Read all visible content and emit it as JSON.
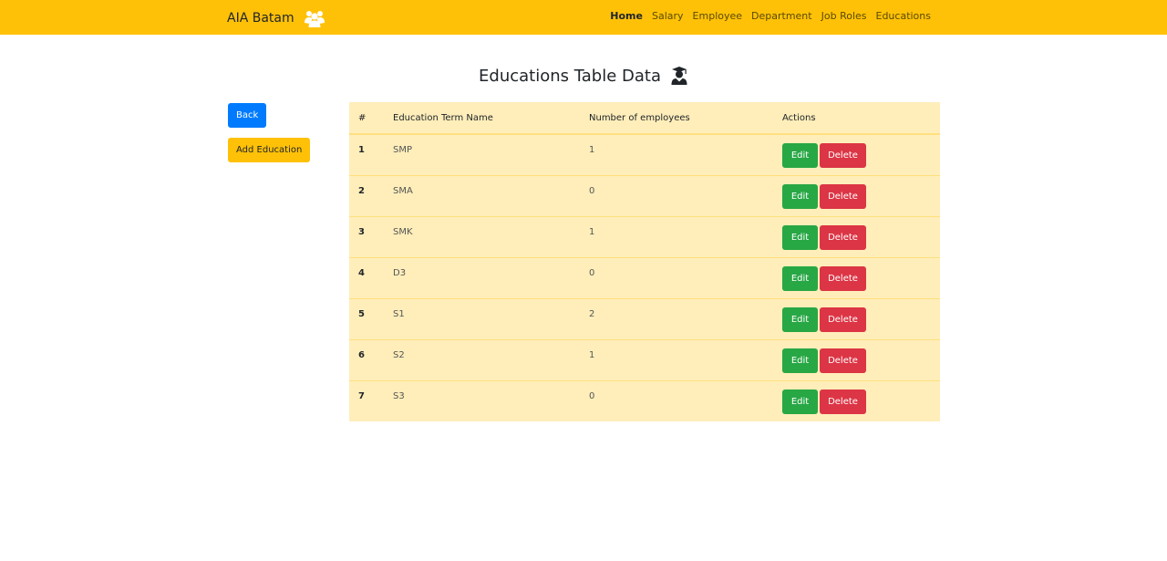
{
  "navbar": {
    "brand": "AIA Batam",
    "brand_icon": "users-icon",
    "links": [
      {
        "label": "Home",
        "active": true
      },
      {
        "label": "Salary",
        "active": false
      },
      {
        "label": "Employee",
        "active": false
      },
      {
        "label": "Department",
        "active": false
      },
      {
        "label": "Job Roles",
        "active": false
      },
      {
        "label": "Educations",
        "active": false
      }
    ]
  },
  "page": {
    "title": "Educations Table Data",
    "title_icon": "user-graduate-icon"
  },
  "sidebar": {
    "back_label": "Back",
    "add_label": "Add Education"
  },
  "table": {
    "headers": [
      "#",
      "Education Term Name",
      "Number of employees",
      "Actions"
    ],
    "rows": [
      {
        "num": "1",
        "name": "SMP",
        "count": "1"
      },
      {
        "num": "2",
        "name": "SMA",
        "count": "0"
      },
      {
        "num": "3",
        "name": "SMK",
        "count": "1"
      },
      {
        "num": "4",
        "name": "D3",
        "count": "0"
      },
      {
        "num": "5",
        "name": "S1",
        "count": "2"
      },
      {
        "num": "6",
        "name": "S2",
        "count": "1"
      },
      {
        "num": "7",
        "name": "S3",
        "count": "0"
      }
    ],
    "edit_label": "Edit",
    "delete_label": "Delete"
  },
  "colors": {
    "navbar": "#ffc107",
    "primary": "#007bff",
    "warning": "#ffc107",
    "success": "#28a745",
    "danger": "#dc3545",
    "table_bg": "#ffeeba"
  }
}
